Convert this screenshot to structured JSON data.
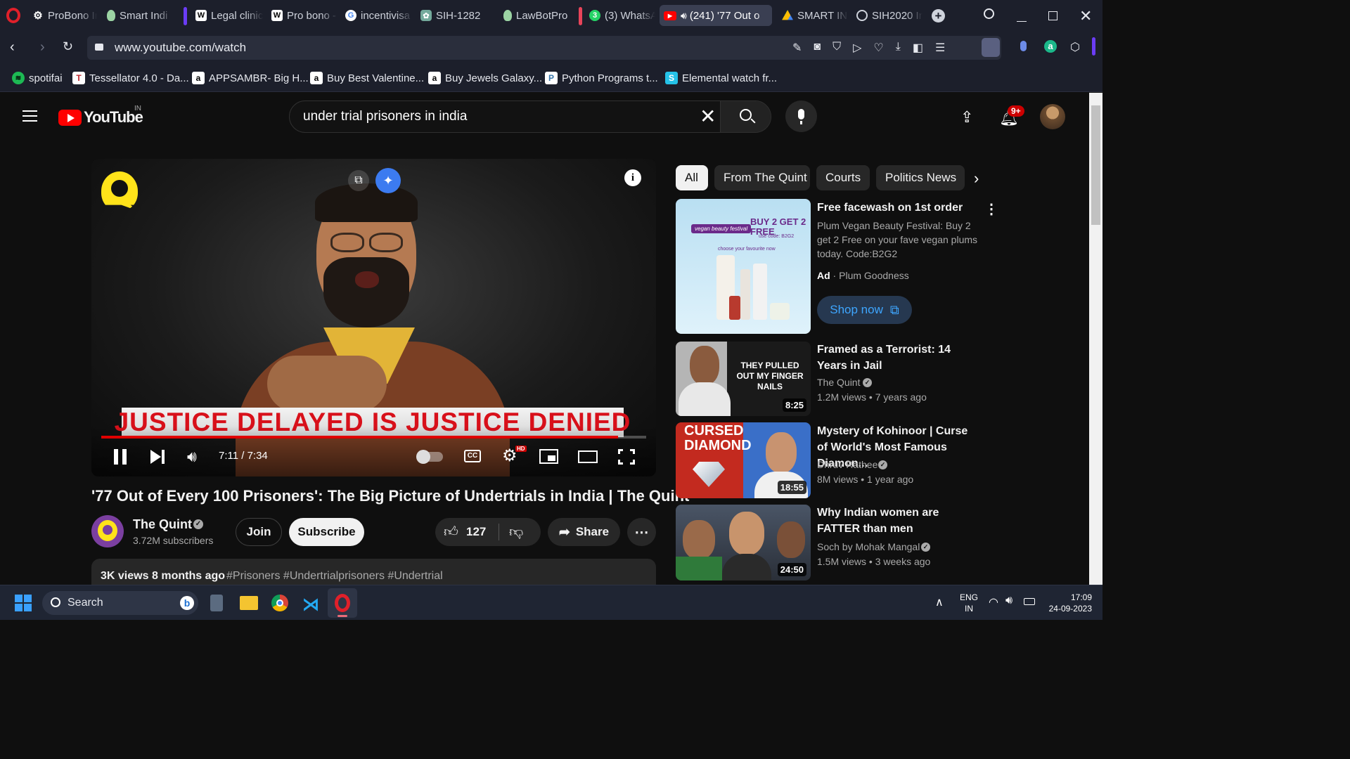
{
  "browser": {
    "tabs": [
      {
        "label": "ProBono Ir",
        "icon": "gear-icon"
      },
      {
        "label": "Smart Indi",
        "icon": "bulb-icon"
      },
      {
        "label": "Legal clinic",
        "icon": "wikipedia-icon"
      },
      {
        "label": "Pro bono -",
        "icon": "wikipedia-icon"
      },
      {
        "label": "incentivisa",
        "icon": "google-icon"
      },
      {
        "label": "SIH-1282",
        "icon": "chatgpt-icon"
      },
      {
        "label": "LawBotPro",
        "icon": "bulb-icon"
      },
      {
        "label": "(3) WhatsA",
        "icon": "whatsapp-icon"
      },
      {
        "label": "(241) '77 Out o",
        "icon": "youtube-icon"
      },
      {
        "label": "SMART IN",
        "icon": "drive-icon"
      },
      {
        "label": "SIH2020 In",
        "icon": "web-icon"
      }
    ],
    "active_tab": "(241) '77 Out o",
    "url": "www.youtube.com/watch",
    "bookmarks": [
      {
        "label": "spotifai",
        "icon": "spotify-icon"
      },
      {
        "label": "Tessellator 4.0 - Da...",
        "icon": "tessellator-icon"
      },
      {
        "label": "APPSAMBR- Big H...",
        "icon": "amazon-icon"
      },
      {
        "label": "Buy Best Valentine...",
        "icon": "amazon-icon"
      },
      {
        "label": "Buy Jewels Galaxy...",
        "icon": "amazon-icon"
      },
      {
        "label": "Python Programs t...",
        "icon": "python-icon"
      },
      {
        "label": "Elemental watch fr...",
        "icon": "elemental-icon"
      }
    ]
  },
  "youtube": {
    "logo_text": "YouTube",
    "region": "IN",
    "search_query": "under trial prisoners in india",
    "notification_count": "9+",
    "chips": [
      "All",
      "From The Quint",
      "Courts",
      "Politics News"
    ],
    "player": {
      "banner": "JUSTICE DELAYED IS JUSTICE DENIED",
      "time": "7:11 / 7:34",
      "progress": 0.949,
      "hd_badge": "HD"
    },
    "video": {
      "title": "'77 Out of Every 100 Prisoners': The Big Picture of Undertrials in India | The Quint",
      "channel": "The Quint",
      "subscribers": "3.72M subscribers",
      "join_label": "Join",
      "subscribe_label": "Subscribe",
      "likes": "127",
      "share_label": "Share",
      "views": "3K views",
      "age": "8 months ago",
      "hashtags": "#Prisoners #Undertrialprisoners #Undertrial"
    },
    "ad": {
      "title": "Free facewash on 1st order",
      "desc": "Plum Vegan Beauty Festival: Buy 2 get 2 Free on your fave vegan plums today. Code:B2G2",
      "ad_label": "Ad",
      "advertiser": "Plum Goodness",
      "cta": "Shop now",
      "thumb_badge": "BUY 2 GET 2 FREE",
      "thumb_festival": "vegan beauty festival",
      "thumb_code": "use code: B2G2",
      "thumb_choose": "choose your favourite now"
    },
    "recommendations": [
      {
        "title": "Framed as a Terrorist: 14 Years in Jail",
        "channel": "The Quint",
        "views": "1.2M views",
        "age": "7 years ago",
        "duration": "8:25",
        "thumb_text": "THEY PULLED OUT MY FINGER NAILS"
      },
      {
        "title": "Mystery of Kohinoor | Curse of World's Most Famous Diamon...",
        "channel": "Dhruv Rathee",
        "views": "8M views",
        "age": "1 year ago",
        "duration": "18:55",
        "thumb_text": "CURSED DIAMOND"
      },
      {
        "title": "Why Indian women are FATTER than men",
        "channel": "Soch by Mohak Mangal",
        "views": "1.5M views",
        "age": "3 weeks ago",
        "duration": "24:50",
        "thumb_text": ""
      }
    ]
  },
  "taskbar": {
    "search_label": "Search",
    "lang": "ENG",
    "region": "IN",
    "time": "17:09",
    "date": "24-09-2023"
  }
}
